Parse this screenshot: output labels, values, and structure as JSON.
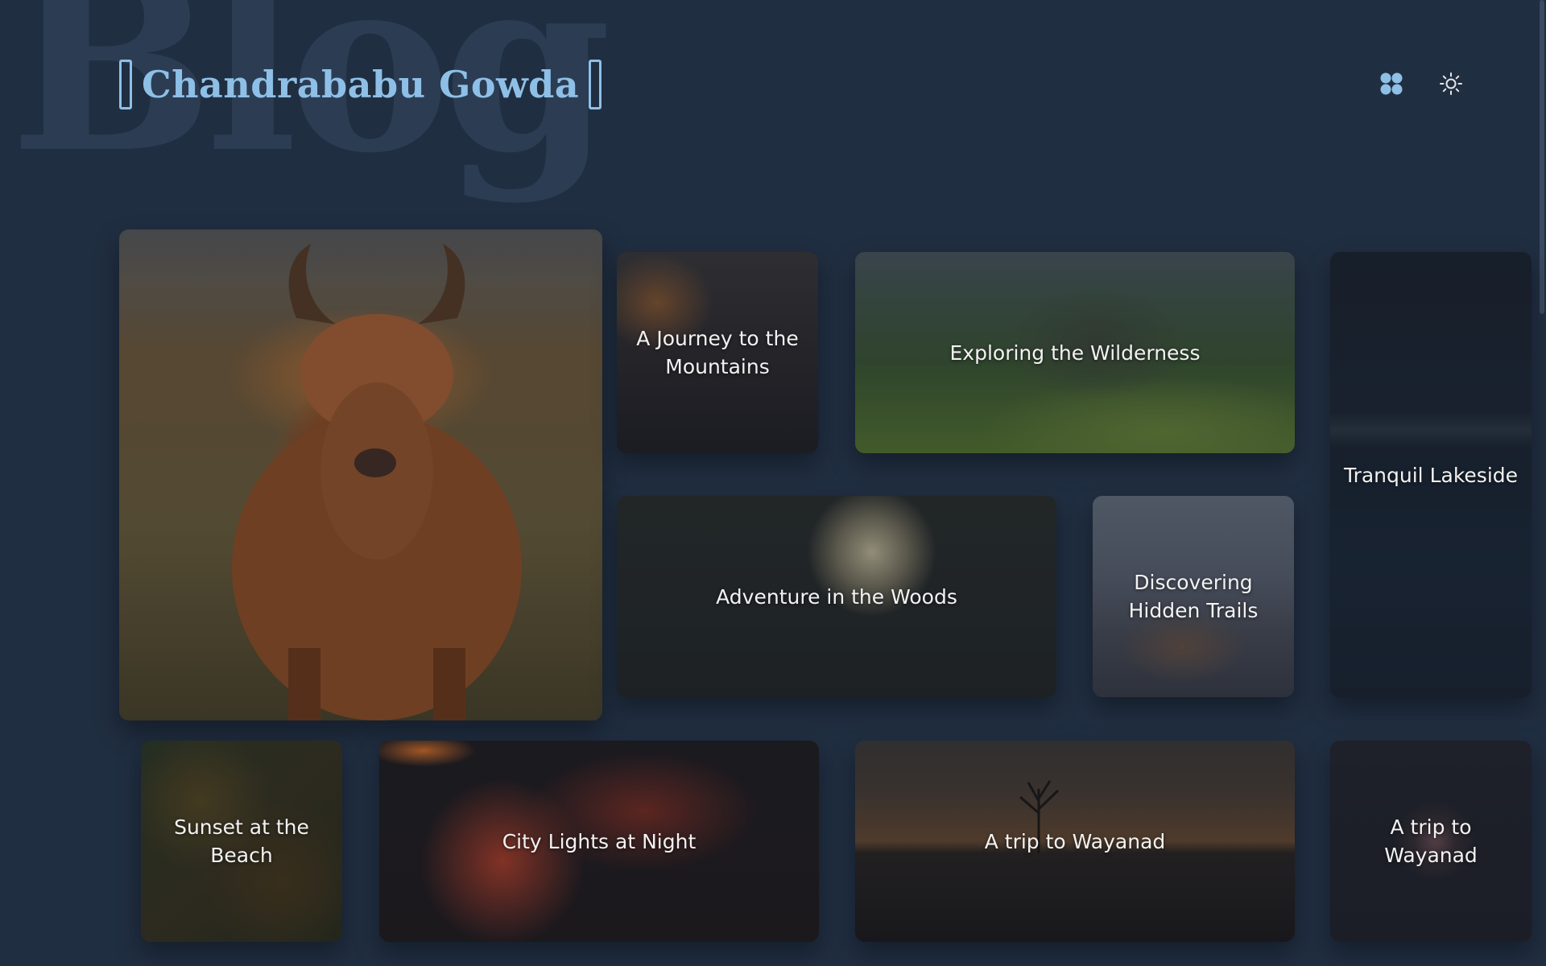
{
  "header": {
    "watermark": "Blog",
    "site_title": "Chandrababu Gowda",
    "apps_icon": "apps-grid-icon",
    "theme_icon": "sun-icon"
  },
  "colors": {
    "background": "#202e41",
    "accent": "#8ec0e7",
    "watermark": "#2c3d53"
  },
  "posts": [
    {
      "title": "",
      "image": "highland-cow"
    },
    {
      "title": "A Journey to the Mountains",
      "image": "mountain-clouds"
    },
    {
      "title": "Exploring the Wilderness",
      "image": "green-hills"
    },
    {
      "title": "Tranquil Lakeside",
      "image": "night-lake"
    },
    {
      "title": "Adventure in the Woods",
      "image": "flowers-moon"
    },
    {
      "title": "Discovering Hidden Trails",
      "image": "volcano-valley"
    },
    {
      "title": "Sunset at the Beach",
      "image": "forest-aerial"
    },
    {
      "title": "City Lights at Night",
      "image": "lava-flow"
    },
    {
      "title": "A trip to Wayanad",
      "image": "sunset-tree"
    },
    {
      "title": "A trip to Wayanad",
      "image": "starry-sky"
    }
  ]
}
